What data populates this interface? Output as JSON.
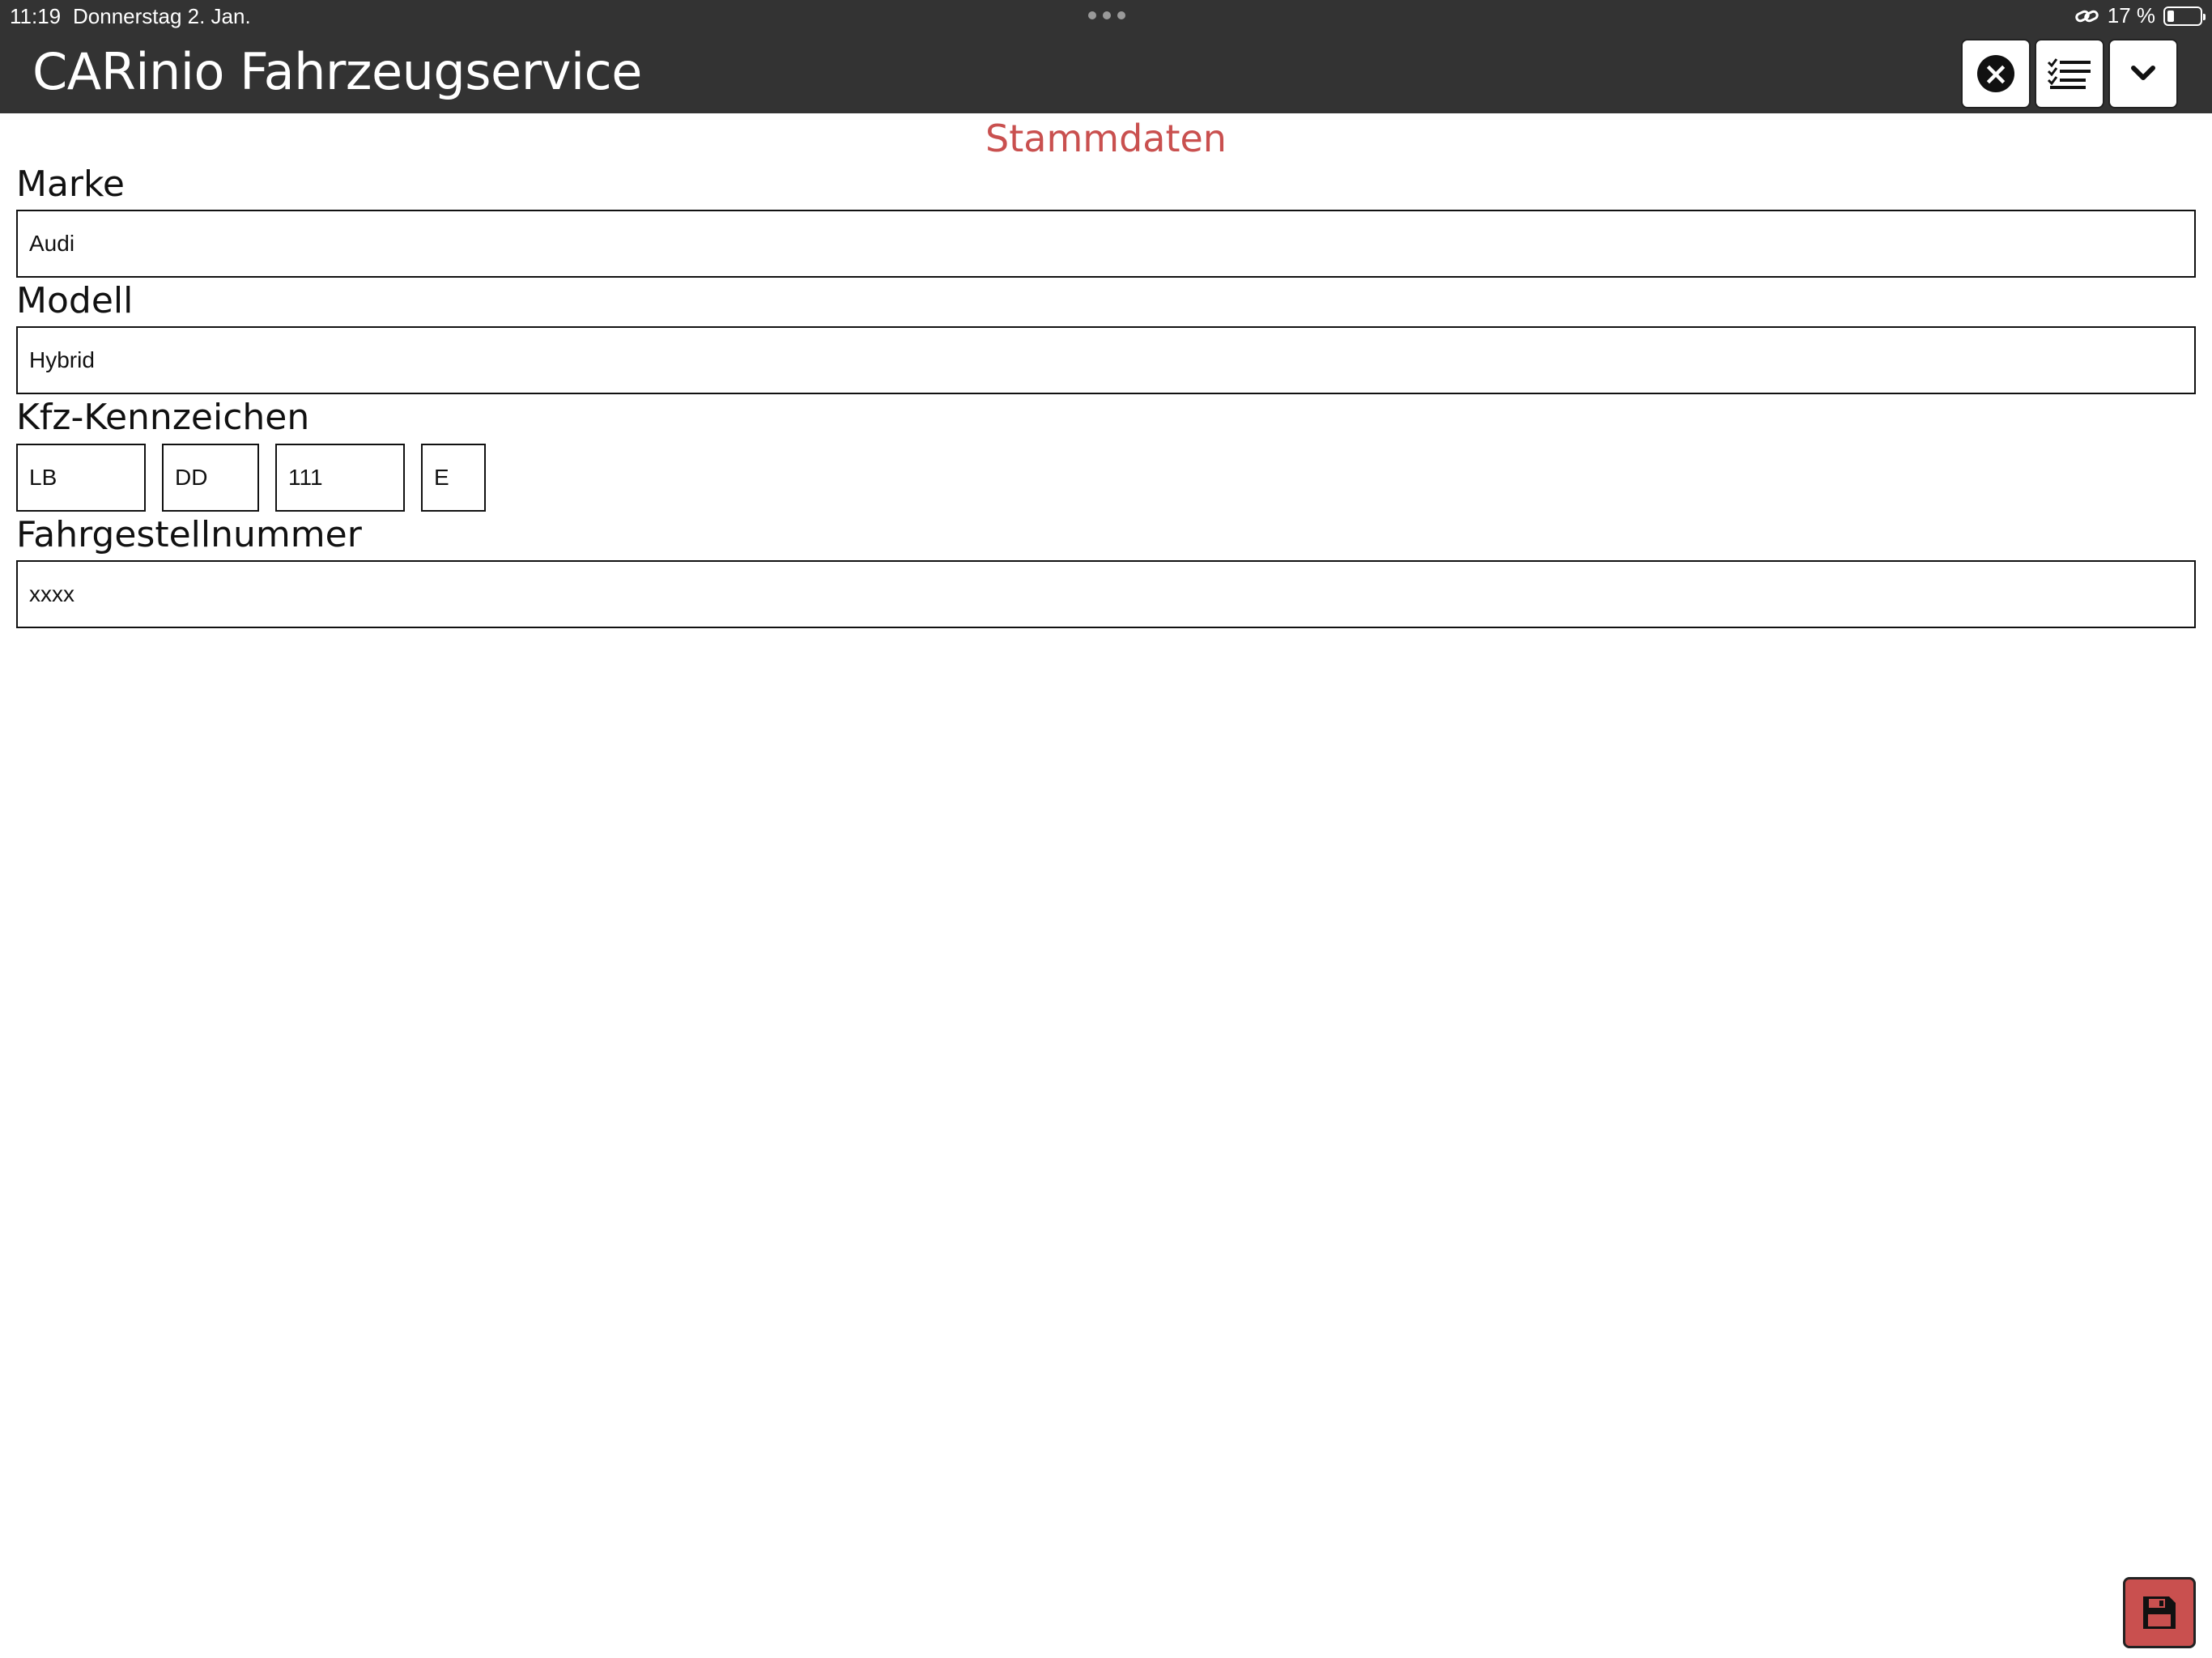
{
  "status_bar": {
    "time": "11:19",
    "date": "Donnerstag 2. Jan.",
    "battery": "17 %"
  },
  "app": {
    "title": "CARinio Fahrzeugservice",
    "actions": [
      "close-icon",
      "checklist-icon",
      "chevron-down-icon"
    ]
  },
  "form": {
    "section_title": "Stammdaten",
    "fields": [
      {
        "label": "Marke",
        "value": "Audi"
      },
      {
        "label": "Modell",
        "value": "Hybrid"
      },
      {
        "label": "Kfz-Kennzeichen",
        "parts": [
          "LB",
          "DD",
          "111",
          "E"
        ]
      },
      {
        "label": "Fahrgestellnummer",
        "value": "xxxx"
      }
    ],
    "save_icon": "floppy-disk-icon"
  },
  "colors": {
    "bar": "#333333",
    "accent": "#c9504f"
  }
}
